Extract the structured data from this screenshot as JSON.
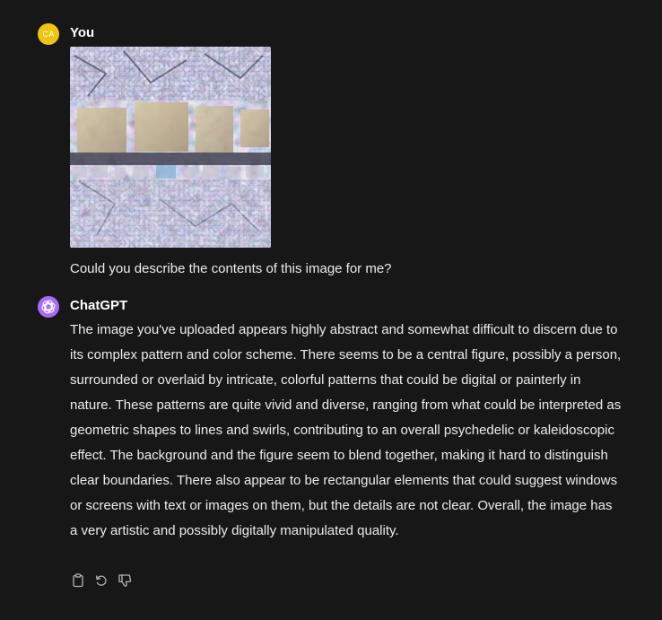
{
  "conversation": {
    "user_turn": {
      "avatar_initials": "CA",
      "avatar_color": "#f1c40f",
      "author": "You",
      "image_icon": "uploaded-image",
      "message": "Could you describe the contents of this image for me?"
    },
    "assistant_turn": {
      "avatar_icon": "openai-logo-icon",
      "avatar_color": "#ab68ff",
      "author": "ChatGPT",
      "message": "The image you've uploaded appears highly abstract and somewhat difficult to discern due to its complex pattern and color scheme. There seems to be a central figure, possibly a person, surrounded or overlaid by intricate, colorful patterns that could be digital or painterly in nature. These patterns are quite vivid and diverse, ranging from what could be interpreted as geometric shapes to lines and swirls, contributing to an overall psychedelic or kaleidoscopic effect. The background and the figure seem to blend together, making it hard to distinguish clear boundaries. There also appear to be rectangular elements that could suggest windows or screens with text or images on them, but the details are not clear. Overall, the image has a very artistic and possibly digitally manipulated quality.",
      "actions": [
        {
          "icon": "clipboard-icon"
        },
        {
          "icon": "regenerate-icon"
        },
        {
          "icon": "thumbs-down-icon"
        }
      ]
    }
  },
  "colors": {
    "background": "#171717",
    "text": "#ececec",
    "icon": "#b4b4b4"
  }
}
